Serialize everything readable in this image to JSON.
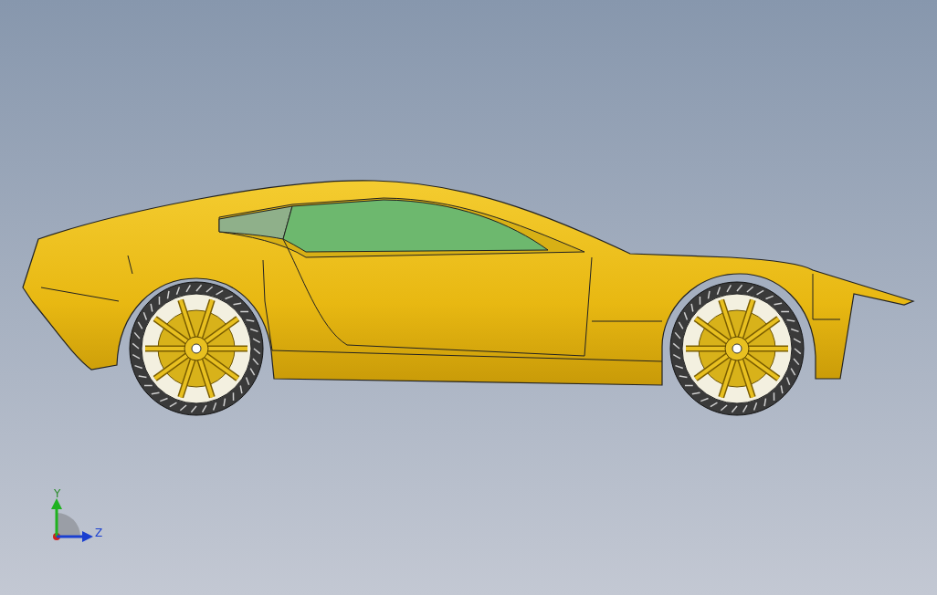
{
  "viewport": {
    "triad": {
      "axes": [
        {
          "kind": "y",
          "label": "Y"
        },
        {
          "kind": "z",
          "label": "Z"
        }
      ]
    }
  }
}
